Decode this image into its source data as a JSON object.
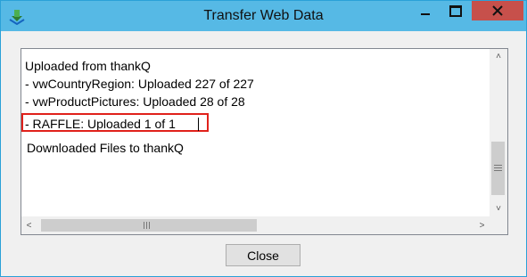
{
  "window": {
    "title": "Transfer Web Data",
    "titlebar_color": "#56b9e5",
    "close_color": "#c7504b"
  },
  "log": {
    "lines": [
      "Uploaded from thankQ",
      " - vwCountryRegion: Uploaded 227 of 227",
      " - vwProductPictures: Uploaded 28 of 28",
      " - RAFFLE: Uploaded 1 of 1",
      "Downloaded Files to thankQ"
    ],
    "highlight_color": "#e0211b"
  },
  "buttons": {
    "close_label": "Close"
  },
  "icons": {
    "app": "download-arrow-icon",
    "minimize": "minimize-icon",
    "maximize": "maximize-icon",
    "close": "close-icon"
  },
  "scroll": {
    "up_glyph": "˄",
    "down_glyph": "˅",
    "left_glyph": "<",
    "right_glyph": ">"
  }
}
